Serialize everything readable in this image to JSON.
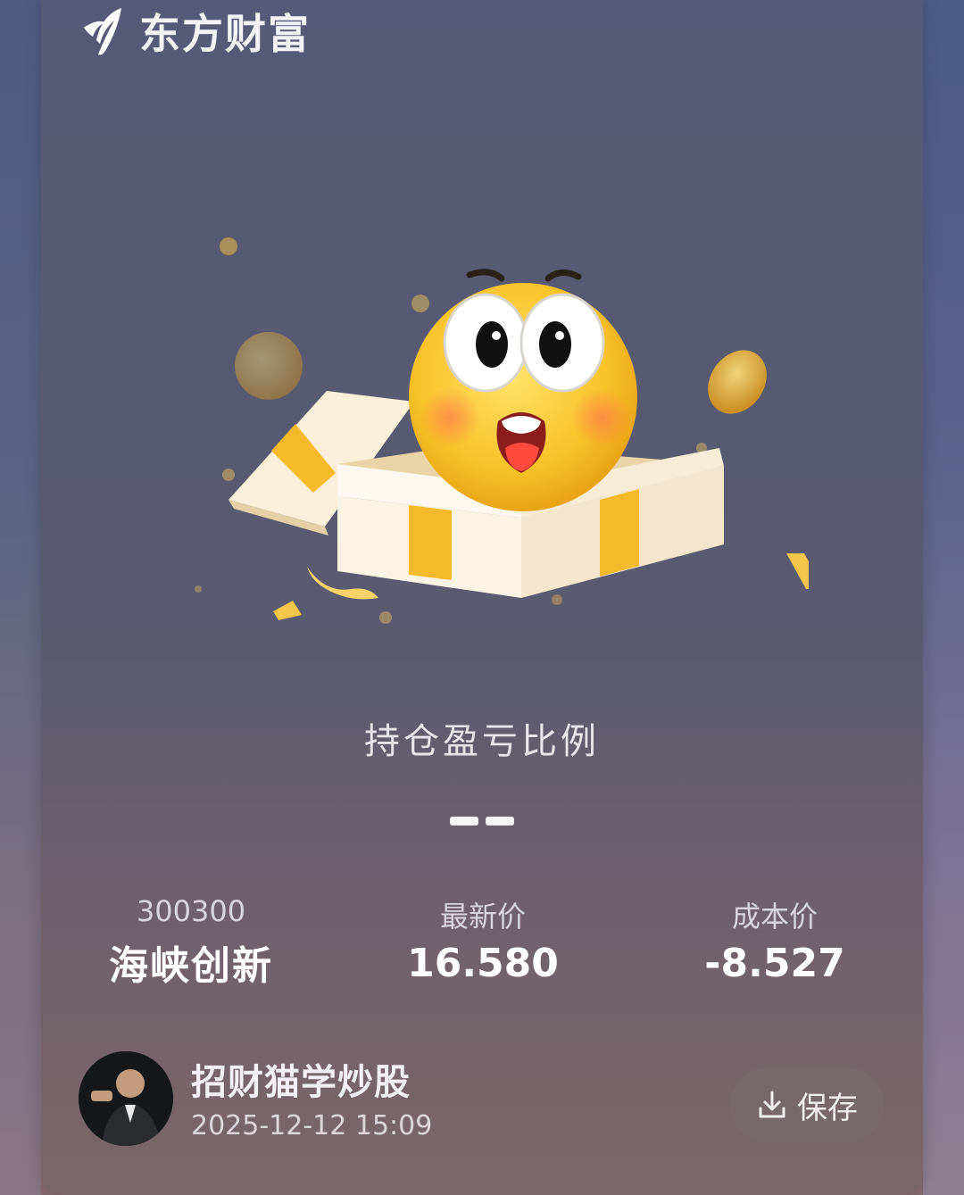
{
  "brand": {
    "name": "东方财富",
    "icon": "eastmoney-logo-icon"
  },
  "card": {
    "title": "持仓盈亏比例",
    "ratio_placeholder": "--",
    "stock": {
      "code": "300300",
      "name": "海峡创新"
    },
    "latest_price": {
      "label": "最新价",
      "value": "16.580"
    },
    "cost_price": {
      "label": "成本价",
      "value": "-8.527"
    }
  },
  "footer": {
    "user_name": "招财猫学炒股",
    "timestamp": "2025-12-12 15:09",
    "save_label": "保存",
    "save_icon": "download-icon"
  },
  "colors": {
    "accent_gold": "#f6b92a",
    "text_white": "#ffffff"
  }
}
